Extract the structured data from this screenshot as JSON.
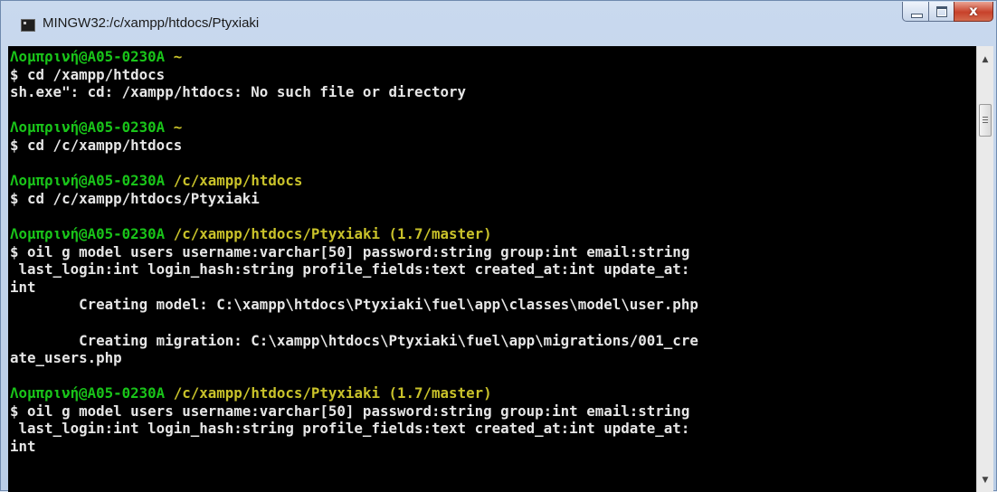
{
  "window": {
    "title": "MINGW32:/c/xampp/htdocs/Ptyxiaki",
    "minimize_label": "minimize",
    "maximize_label": "maximize",
    "close_glyph": "x",
    "icons": [
      "terminal-app-icon",
      "minimize-icon",
      "maximize-icon",
      "close-icon",
      "scroll-up-arrow-icon",
      "scroll-down-arrow-icon"
    ]
  },
  "colors": {
    "console_bg": "#000000",
    "text": "#e6e6e6",
    "prompt_user": "#19c419",
    "prompt_path": "#c9c22a",
    "close_button": "#c8412a"
  },
  "console": {
    "blocks": [
      {
        "user": "Λομπρινή@A05-0230A",
        "path": "~",
        "lines": [
          "$ cd /xampp/htdocs",
          "sh.exe\": cd: /xampp/htdocs: No such file or directory"
        ]
      },
      {
        "user": "Λομπρινή@A05-0230A",
        "path": "~",
        "lines": [
          "$ cd /c/xampp/htdocs"
        ]
      },
      {
        "user": "Λομπρινή@A05-0230A",
        "path": "/c/xampp/htdocs",
        "lines": [
          "$ cd /c/xampp/htdocs/Ptyxiaki"
        ]
      },
      {
        "user": "Λομπρινή@A05-0230A",
        "path": "/c/xampp/htdocs/Ptyxiaki (1.7/master)",
        "lines": [
          "$ oil g model users username:varchar[50] password:string group:int email:string",
          " last_login:int login_hash:string profile_fields:text created_at:int update_at:",
          "int",
          "        Creating model: C:\\xampp\\htdocs\\Ptyxiaki\\fuel\\app\\classes\\model\\user.php",
          "",
          "        Creating migration: C:\\xampp\\htdocs\\Ptyxiaki\\fuel\\app\\migrations/001_cre",
          "ate_users.php"
        ]
      },
      {
        "user": "Λομπρινή@A05-0230A",
        "path": "/c/xampp/htdocs/Ptyxiaki (1.7/master)",
        "lines": [
          "$ oil g model users username:varchar[50] password:string group:int email:string",
          " last_login:int login_hash:string profile_fields:text created_at:int update_at:",
          "int"
        ]
      }
    ]
  }
}
